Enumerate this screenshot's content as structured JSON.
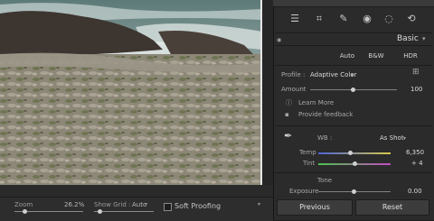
{
  "top_notice": "",
  "toolbar": {
    "icons": [
      "edit-sliders-icon",
      "crop-icon",
      "heal-icon",
      "redeye-icon",
      "masking-icon",
      "presets-icon"
    ]
  },
  "basic_panel": {
    "title": "Basic",
    "buttons": {
      "auto": "Auto",
      "bw": "B&W",
      "hdr": "HDR"
    },
    "profile_label": "Profile :",
    "profile_value": "Adaptive Color",
    "amount_label": "Amount",
    "amount_value": "100",
    "learn_more": "Learn More",
    "provide_feedback": "Provide feedback",
    "wb_label": "WB :",
    "wb_value": "As Shot",
    "temp_label": "Temp",
    "temp_value": "6,350",
    "tint_label": "Tint",
    "tint_value": "+ 4",
    "tone_label": "Tone",
    "exposure_label": "Exposure",
    "exposure_value": "0.00"
  },
  "bottom_bar": {
    "zoom_label": "Zoom",
    "zoom_value": "26.2%",
    "show_grid_label": "Show Grid :",
    "show_grid_value": "Auto",
    "soft_proofing_label": "Soft Proofing"
  },
  "footer_buttons": {
    "previous": "Previous",
    "reset": "Reset"
  },
  "colors": {
    "panel_bg": "#2b2b2b",
    "accent_temp": "#6f6fd6",
    "accent_tint": "#c56bc5"
  }
}
